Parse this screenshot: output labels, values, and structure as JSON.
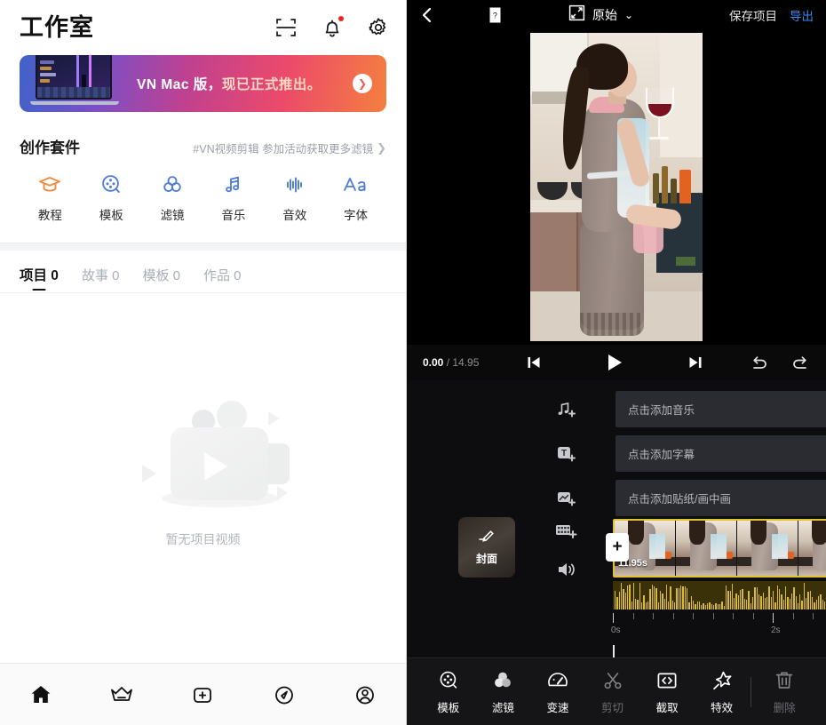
{
  "left": {
    "header": {
      "title": "工作室",
      "icons": [
        {
          "name": "scan-icon"
        },
        {
          "name": "notification-bell-icon",
          "badge": true
        },
        {
          "name": "settings-gear-icon"
        }
      ]
    },
    "banner": {
      "text_plain": "VN Mac 版，",
      "text_accent": "现已正式推出。",
      "arrow": "❯"
    },
    "kit": {
      "title": "创作套件",
      "subtitle": "#VN视频剪辑 参加活动获取更多滤镜",
      "chevron": "❯",
      "items": [
        {
          "label": "教程",
          "icon": "graduation-cap-icon"
        },
        {
          "label": "模板",
          "icon": "film-reel-icon"
        },
        {
          "label": "滤镜",
          "icon": "color-circles-icon"
        },
        {
          "label": "音乐",
          "icon": "music-note-icon"
        },
        {
          "label": "音效",
          "icon": "sound-wave-icon"
        },
        {
          "label": "字体",
          "icon": "text-aa-icon"
        }
      ]
    },
    "tabs": [
      {
        "label": "项目 0",
        "active": true
      },
      {
        "label": "故事 0",
        "active": false
      },
      {
        "label": "模板 0",
        "active": false
      },
      {
        "label": "作品 0",
        "active": false
      }
    ],
    "empty_text": "暂无项目视频",
    "nav": [
      {
        "name": "home-icon"
      },
      {
        "name": "crown-icon"
      },
      {
        "name": "plus-square-icon"
      },
      {
        "name": "compass-icon"
      },
      {
        "name": "profile-icon"
      }
    ]
  },
  "right": {
    "topbar": {
      "back": "back-chevron-icon",
      "help": "help-book-icon",
      "ratio_icon": "expand-arrows-icon",
      "ratio_label": "原始",
      "ratio_chevron": "⌄",
      "save_label": "保存项目",
      "export_label": "导出"
    },
    "transport": {
      "current_time": "0.00",
      "separator": " / ",
      "total_time": "14.95",
      "buttons": [
        {
          "name": "skip-to-start-icon"
        },
        {
          "name": "play-icon"
        },
        {
          "name": "skip-to-end-icon"
        },
        {
          "name": "undo-icon"
        },
        {
          "name": "redo-icon"
        }
      ]
    },
    "timeline": {
      "tracks": [
        {
          "icon": "add-music-icon",
          "placeholder": "点击添加音乐"
        },
        {
          "icon": "add-text-icon",
          "placeholder": "点击添加字幕"
        },
        {
          "icon": "add-sticker-icon",
          "placeholder": "点击添加贴纸/画中画"
        }
      ],
      "cover_label": "封面",
      "cover_icon": "pencil-edit-icon",
      "add_clip_icon": "add-film-icon",
      "volume_icon": "volume-icon",
      "insert_button": "+",
      "clip_duration": "11.95s",
      "ruler_labels": [
        "0s",
        "2s"
      ]
    },
    "toolbar": [
      {
        "label": "模板",
        "icon": "film-reel-icon",
        "dimmed": false
      },
      {
        "label": "滤镜",
        "icon": "color-circles-icon",
        "dimmed": false
      },
      {
        "label": "变速",
        "icon": "speedometer-icon",
        "dimmed": false
      },
      {
        "label": "剪切",
        "icon": "scissors-icon",
        "dimmed": true
      },
      {
        "label": "截取",
        "icon": "crop-brackets-icon",
        "dimmed": false
      },
      {
        "label": "特效",
        "icon": "star-sparkle-icon",
        "dimmed": false
      },
      {
        "label": "删除",
        "icon": "trash-icon",
        "dimmed": true
      }
    ]
  },
  "colors": {
    "accent_blue": "#3b8df0",
    "clip_border": "#e0c232",
    "badge_red": "#f22222"
  }
}
